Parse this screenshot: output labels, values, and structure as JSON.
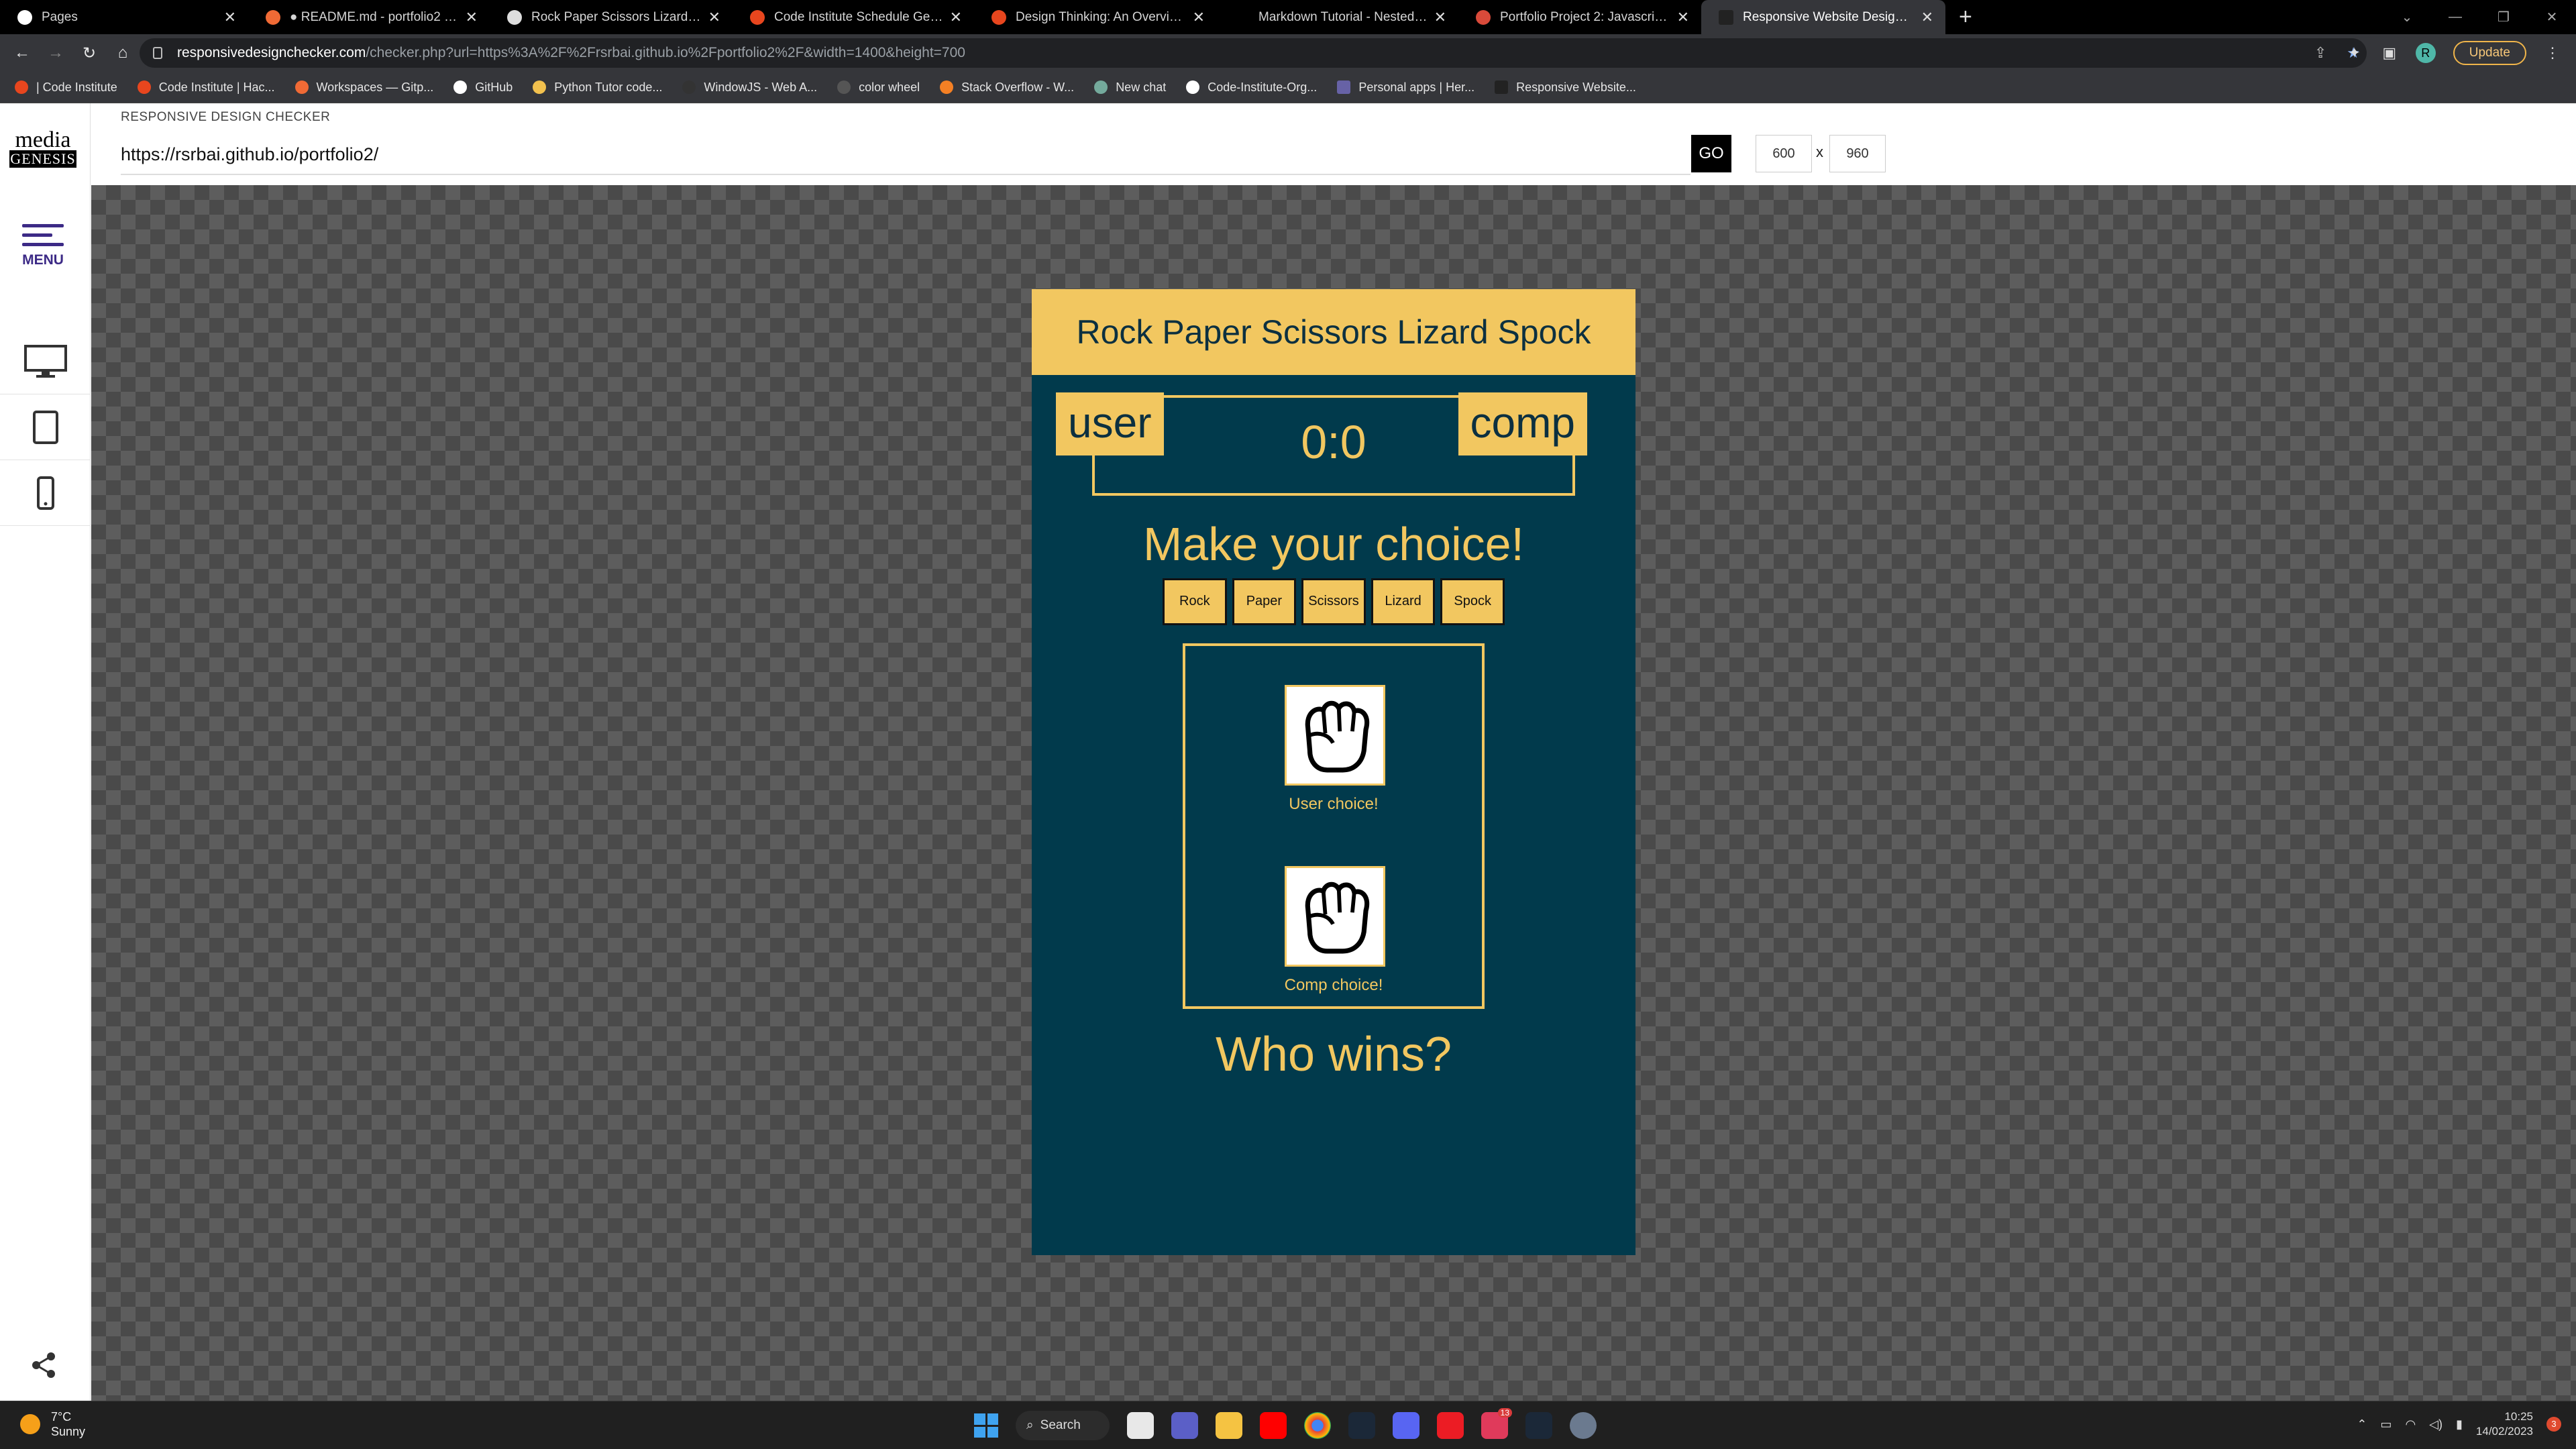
{
  "browser": {
    "tabs": [
      {
        "title": "Pages",
        "color": "#ffffff"
      },
      {
        "title": "● README.md - portfolio2 - Gitp",
        "color": "#f06a35"
      },
      {
        "title": "Rock Paper Scissors Lizard Spock",
        "color": "#e0e0e0"
      },
      {
        "title": "Code Institute Schedule Generat",
        "color": "#e8461e"
      },
      {
        "title": "Design Thinking: An Overview | C",
        "color": "#e8461e"
      },
      {
        "title": "Markdown Tutorial - Nested Lists",
        "color": "#000000"
      },
      {
        "title": "Portfolio Project 2: Javascript Ess",
        "color": "#d94a3a"
      },
      {
        "title": "Responsive Website Design Testi",
        "color": "#222222"
      }
    ],
    "url_host": "responsivedesignchecker.com",
    "url_path": "/checker.php?url=https%3A%2F%2Frsrbai.github.io%2Fportfolio2%2F&width=1400&height=700",
    "update_label": "Update",
    "profile_initial": "R",
    "bookmarks": [
      {
        "label": "| Code Institute",
        "color": "#e8461e"
      },
      {
        "label": "Code Institute | Hac...",
        "color": "#e8461e"
      },
      {
        "label": "Workspaces — Gitp...",
        "color": "#f06a35"
      },
      {
        "label": "GitHub",
        "color": "#ffffff"
      },
      {
        "label": "Python Tutor code...",
        "color": "#f2c14e"
      },
      {
        "label": "WindowJS - Web A...",
        "color": "#333333"
      },
      {
        "label": "color wheel",
        "color": "#555555"
      },
      {
        "label": "Stack Overflow - W...",
        "color": "#f48024"
      },
      {
        "label": "New chat",
        "color": "#74aa9c"
      },
      {
        "label": "Code-Institute-Org...",
        "color": "#ffffff"
      },
      {
        "label": "Personal apps | Her...",
        "color": "#6762a6"
      },
      {
        "label": "Responsive Website...",
        "color": "#222222"
      }
    ]
  },
  "checker": {
    "logo_top": "media",
    "logo_bottom": "GENESIS",
    "menu_label": "MENU",
    "header_label": "RESPONSIVE DESIGN CHECKER",
    "url_value": "https://rsrbai.github.io/portfolio2/",
    "go_label": "GO",
    "width_value": "600",
    "height_value": "960",
    "x_label": "x",
    "devices": [
      "desktop-icon",
      "tablet-icon",
      "mobile-icon"
    ]
  },
  "game": {
    "title": "Rock Paper Scissors Lizard Spock",
    "user_label": "user",
    "comp_label": "comp",
    "score": "0:0",
    "prompt": "Make your choice!",
    "choices": [
      "Rock",
      "Paper",
      "Scissors",
      "Lizard",
      "Spock"
    ],
    "user_choice_caption": "User choice!",
    "comp_choice_caption": "Comp choice!",
    "result": "Who wins?",
    "colors": {
      "primary": "#f2c760",
      "background": "#013a4c"
    }
  },
  "taskbar": {
    "temperature": "7°C",
    "weather": "Sunny",
    "search_label": "Search",
    "time": "10:25",
    "date": "14/02/2023",
    "notification_count": "3",
    "badge_count": "13"
  }
}
